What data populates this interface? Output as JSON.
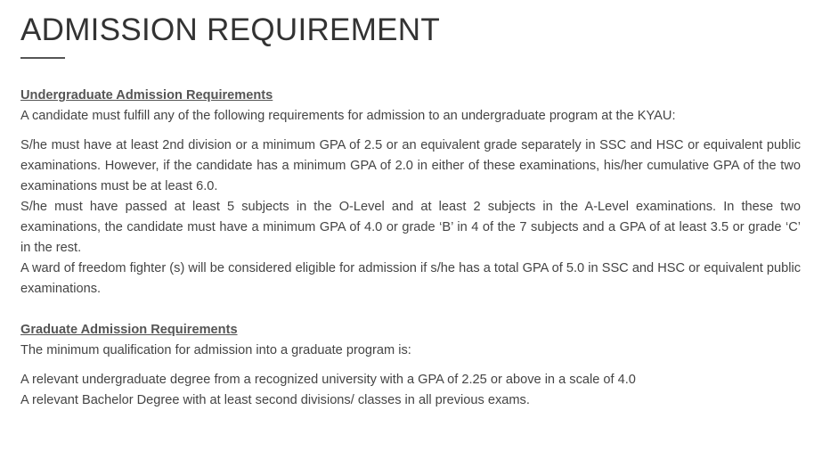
{
  "title": "ADMISSION REQUIREMENT",
  "undergraduate": {
    "heading": "Undergraduate Admission Requirements ",
    "intro": "A candidate must fulfill any of the following requirements for admission to an undergraduate program at the KYAU:",
    "requirements": [
      "S/he must have at least 2nd division or a minimum GPA of 2.5 or an equivalent grade separately in SSC and HSC or equivalent public examinations. However, if the candidate has a minimum GPA of 2.0 in either of these examinations, his/her cumulative GPA of the two examinations must be at least 6.0.",
      "S/he must have passed at least 5 subjects in the O-Level and at least 2 subjects in the A-Level examinations. In these two examinations, the candidate must have a minimum GPA of 4.0 or grade ‘B’ in 4 of the 7 subjects and a GPA of at least 3.5 or grade ‘C’ in the rest.",
      "A ward of freedom fighter (s) will be considered eligible for admission if s/he has a total GPA of 5.0 in SSC and HSC or equivalent public examinations."
    ]
  },
  "graduate": {
    "heading": "Graduate Admission Requirements ",
    "intro": "The minimum qualification for admission into a graduate program is:",
    "requirements": [
      "A relevant undergraduate degree from a recognized university with a GPA of 2.25 or above in a scale of 4.0",
      "A relevant Bachelor Degree with at least second divisions/ classes in all previous exams."
    ]
  }
}
